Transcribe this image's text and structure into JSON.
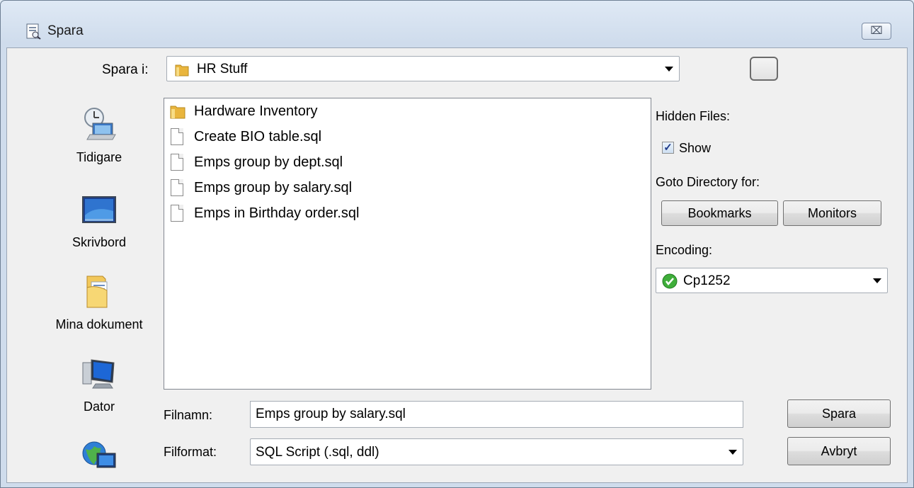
{
  "window": {
    "title": "Spara",
    "close_glyph": "⌧"
  },
  "save_in": {
    "label": "Spara i:",
    "value": "HR Stuff"
  },
  "places": [
    {
      "label": "Tidigare",
      "icon": "recent-places-icon"
    },
    {
      "label": "Skrivbord",
      "icon": "desktop-icon"
    },
    {
      "label": "Mina dokument",
      "icon": "my-documents-icon"
    },
    {
      "label": "Dator",
      "icon": "computer-icon"
    },
    {
      "label": "",
      "icon": "network-icon"
    }
  ],
  "files": [
    {
      "name": "Hardware Inventory",
      "type": "folder"
    },
    {
      "name": "Create BIO table.sql",
      "type": "file"
    },
    {
      "name": "Emps group by dept.sql",
      "type": "file"
    },
    {
      "name": "Emps group by salary.sql",
      "type": "file"
    },
    {
      "name": "Emps in Birthday order.sql",
      "type": "file"
    }
  ],
  "hidden_files": {
    "label": "Hidden Files:",
    "show_label": "Show",
    "checked": true,
    "check_glyph": "✓"
  },
  "goto": {
    "label": "Goto Directory for:",
    "bookmarks": "Bookmarks",
    "monitors": "Monitors"
  },
  "encoding": {
    "label": "Encoding:",
    "value": "Cp1252"
  },
  "filename": {
    "label": "Filnamn:",
    "value": "Emps group by salary.sql"
  },
  "fileformat": {
    "label": "Filformat:",
    "value": "SQL Script (.sql, ddl)"
  },
  "buttons": {
    "save": "Spara",
    "cancel": "Avbryt"
  },
  "colors": {
    "title_bg": "#dfe9f5",
    "client_bg": "#f0f0f0",
    "folder": "#f3c94b",
    "accent_blue": "#1f5fbf"
  }
}
